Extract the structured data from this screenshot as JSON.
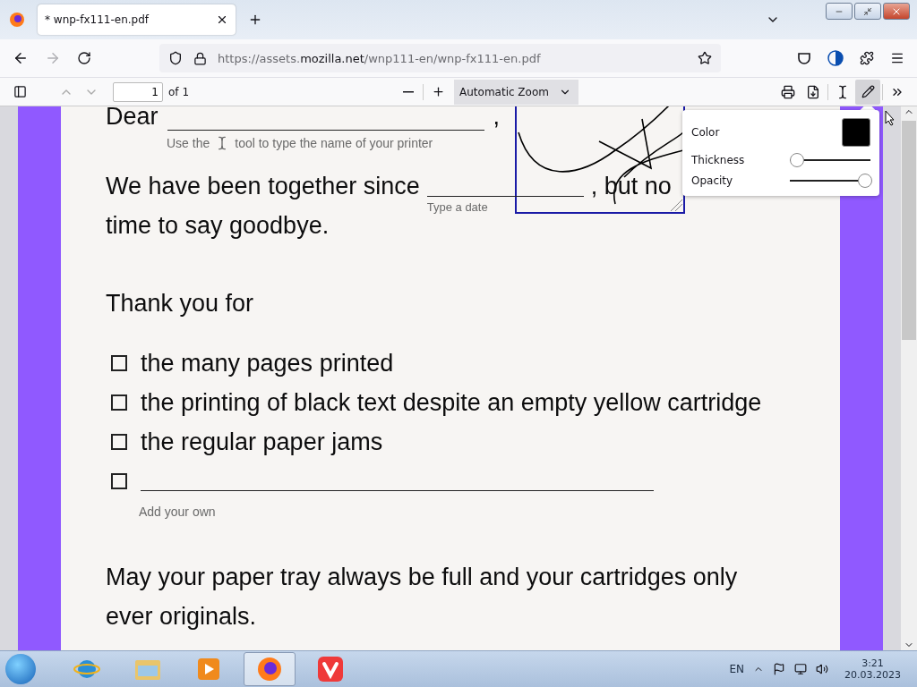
{
  "tabs": [
    {
      "title": "* wnp-fx111-en.pdf",
      "selected": true
    }
  ],
  "address_bar": {
    "url_scheme": "https://assets.",
    "url_domain": "mozilla.net",
    "url_path": "/wnp111-en/wnp-fx111-en.pdf"
  },
  "pdf_toolbar": {
    "page_number": "1",
    "page_count": "of 1",
    "zoom": "Automatic Zoom",
    "draw_tool_selected": true
  },
  "document": {
    "salutation": "Dear",
    "salutation_end": ",",
    "printer_hint_before": "Use the",
    "printer_hint_after": "tool to type the name of your printer",
    "together_before": "We have been together since",
    "together_after": ", but no",
    "together_line2": "time to say goodbye.",
    "date_hint": "Type a date",
    "thanks": "Thank you for",
    "items": [
      {
        "text": "the many pages printed",
        "checked": false
      },
      {
        "text": "the printing of black text despite an empty yellow cartridge",
        "checked": false
      },
      {
        "text": "the regular paper jams",
        "checked": false
      },
      {
        "checked": false,
        "kind": "blank"
      }
    ],
    "own_hint": "Add your own",
    "closing": "May your paper tray always be full and your cartridges only ever originals."
  },
  "ink_popup": {
    "color_label": "Color",
    "color": "#000000",
    "thickness_label": "Thickness",
    "thickness": {
      "level": 0
    },
    "opacity_label": "Opacity",
    "opacity": {
      "level": 1
    }
  },
  "taskbar": {
    "apps": [
      {
        "kind": "ie",
        "selected": false
      },
      {
        "kind": "explorer",
        "selected": false
      },
      {
        "kind": "media",
        "selected": false
      },
      {
        "kind": "firefox",
        "selected": true
      },
      {
        "kind": "vivaldi",
        "selected": false
      }
    ],
    "language": "EN",
    "time": "3:21",
    "date": "20.03.2023"
  }
}
